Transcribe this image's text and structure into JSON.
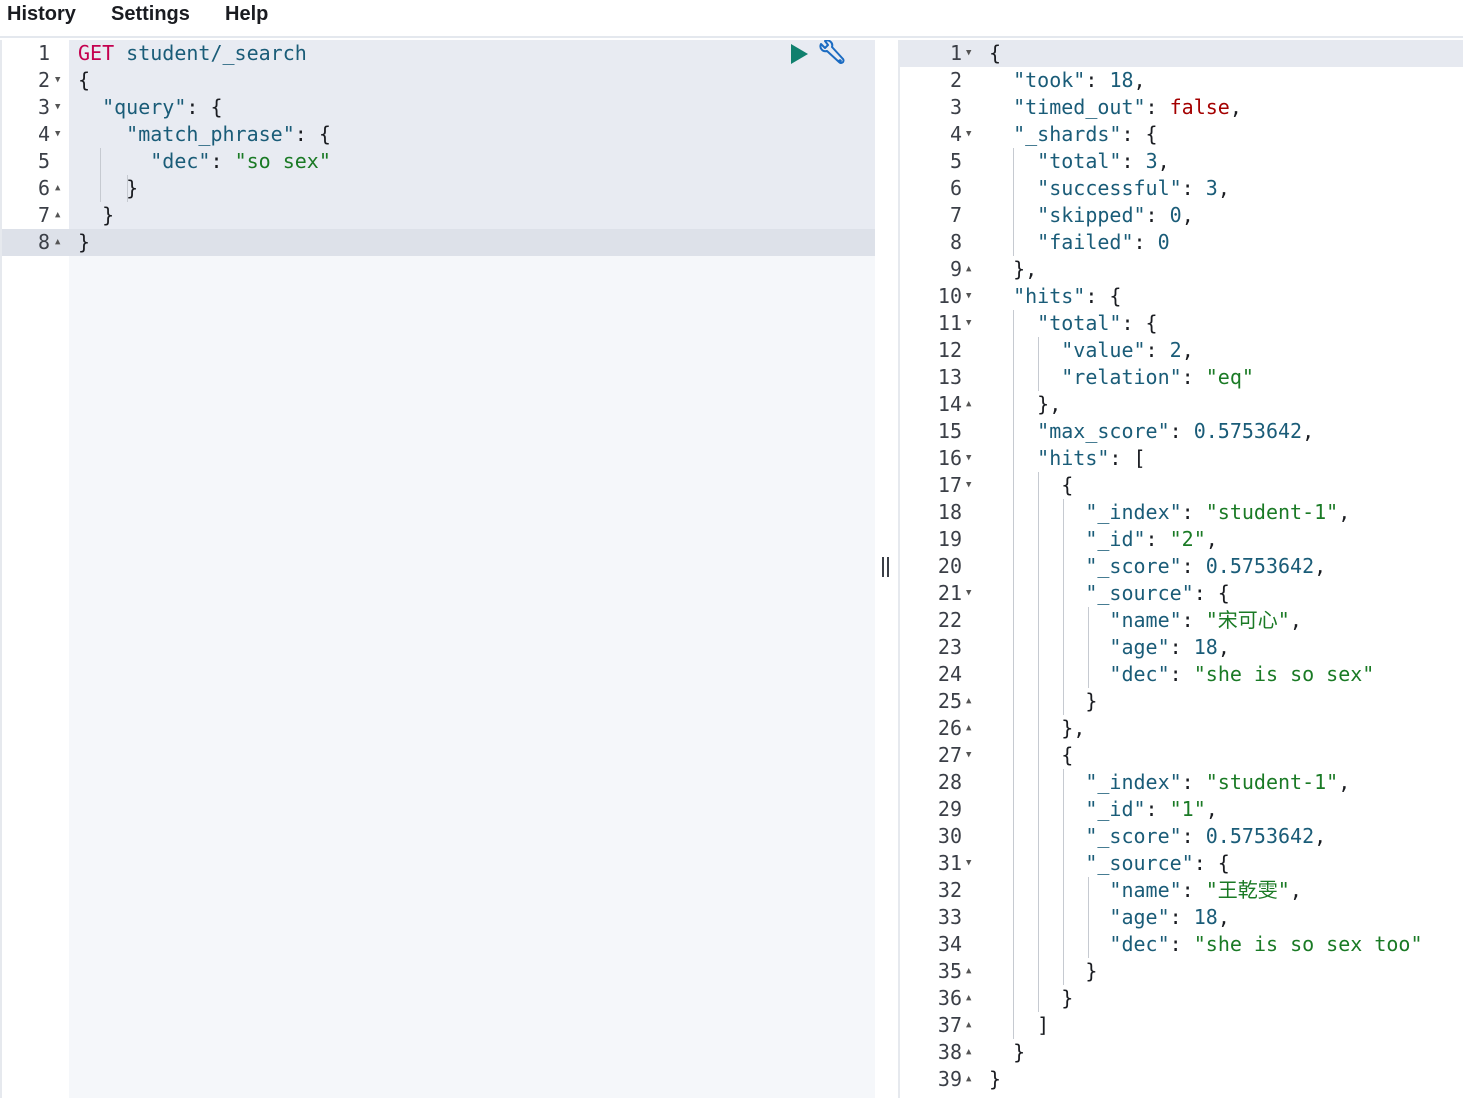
{
  "menu": {
    "history": "History",
    "settings": "Settings",
    "help": "Help"
  },
  "request": {
    "lines": [
      {
        "num": "1",
        "fold": ""
      },
      {
        "num": "2",
        "fold": "down"
      },
      {
        "num": "3",
        "fold": "down"
      },
      {
        "num": "4",
        "fold": "down"
      },
      {
        "num": "5",
        "fold": ""
      },
      {
        "num": "6",
        "fold": "up"
      },
      {
        "num": "7",
        "fold": "up"
      },
      {
        "num": "8",
        "fold": "up"
      }
    ],
    "method": "GET",
    "path": "student/_search",
    "query_key": "\"query\"",
    "match_phrase_key": "\"match_phrase\"",
    "dec_key": "\"dec\"",
    "dec_value": "\"so sex\""
  },
  "toolbar": {
    "run_icon": "play-icon",
    "tools_icon": "wrench-icon"
  },
  "response": {
    "lines": [
      {
        "num": "1",
        "fold": "down"
      },
      {
        "num": "2",
        "fold": ""
      },
      {
        "num": "3",
        "fold": ""
      },
      {
        "num": "4",
        "fold": "down"
      },
      {
        "num": "5",
        "fold": ""
      },
      {
        "num": "6",
        "fold": ""
      },
      {
        "num": "7",
        "fold": ""
      },
      {
        "num": "8",
        "fold": ""
      },
      {
        "num": "9",
        "fold": "up"
      },
      {
        "num": "10",
        "fold": "down"
      },
      {
        "num": "11",
        "fold": "down"
      },
      {
        "num": "12",
        "fold": ""
      },
      {
        "num": "13",
        "fold": ""
      },
      {
        "num": "14",
        "fold": "up"
      },
      {
        "num": "15",
        "fold": ""
      },
      {
        "num": "16",
        "fold": "down"
      },
      {
        "num": "17",
        "fold": "down"
      },
      {
        "num": "18",
        "fold": ""
      },
      {
        "num": "19",
        "fold": ""
      },
      {
        "num": "20",
        "fold": ""
      },
      {
        "num": "21",
        "fold": "down"
      },
      {
        "num": "22",
        "fold": ""
      },
      {
        "num": "23",
        "fold": ""
      },
      {
        "num": "24",
        "fold": ""
      },
      {
        "num": "25",
        "fold": "up"
      },
      {
        "num": "26",
        "fold": "up"
      },
      {
        "num": "27",
        "fold": "down"
      },
      {
        "num": "28",
        "fold": ""
      },
      {
        "num": "29",
        "fold": ""
      },
      {
        "num": "30",
        "fold": ""
      },
      {
        "num": "31",
        "fold": "down"
      },
      {
        "num": "32",
        "fold": ""
      },
      {
        "num": "33",
        "fold": ""
      },
      {
        "num": "34",
        "fold": ""
      },
      {
        "num": "35",
        "fold": "up"
      },
      {
        "num": "36",
        "fold": "up"
      },
      {
        "num": "37",
        "fold": "up"
      },
      {
        "num": "38",
        "fold": "up"
      },
      {
        "num": "39",
        "fold": "up"
      }
    ],
    "took": "18",
    "timed_out": "false",
    "shards": {
      "total": "3",
      "successful": "3",
      "skipped": "0",
      "failed": "0"
    },
    "hits_total": {
      "value": "2",
      "relation": "\"eq\""
    },
    "max_score": "0.5753642",
    "hits": [
      {
        "index": "\"student-1\"",
        "id": "\"2\"",
        "score": "0.5753642",
        "name": "\"宋可心\"",
        "age": "18",
        "dec": "\"she is so sex\""
      },
      {
        "index": "\"student-1\"",
        "id": "\"1\"",
        "score": "0.5753642",
        "name": "\"王乾雯\"",
        "age": "18",
        "dec": "\"she is so sex too\""
      }
    ]
  },
  "splitter": {
    "icon": "drag-handle-icon"
  }
}
